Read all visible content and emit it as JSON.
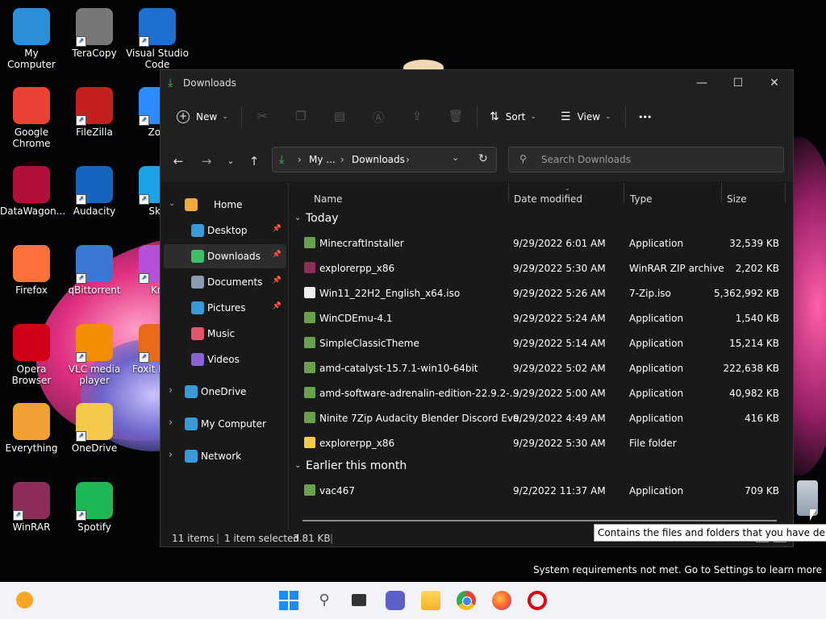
{
  "desktop": {
    "icons": [
      {
        "label": "My Computer",
        "icon": "monitor-icon"
      },
      {
        "label": "TeraCopy",
        "icon": "teracopy-icon"
      },
      {
        "label": "Visual Studio Code",
        "icon": "vscode-icon"
      },
      {
        "label": "Google Chrome",
        "icon": "chrome-icon"
      },
      {
        "label": "FileZilla",
        "icon": "filezilla-icon"
      },
      {
        "label": "Zoo",
        "icon": "zoom-icon"
      },
      {
        "label": "DataWagon...",
        "icon": "datawagon-icon"
      },
      {
        "label": "Audacity",
        "icon": "audacity-icon"
      },
      {
        "label": "Sky",
        "icon": "skype-icon"
      },
      {
        "label": "Firefox",
        "icon": "firefox-icon"
      },
      {
        "label": "qBittorrent",
        "icon": "qbittorrent-icon"
      },
      {
        "label": "Kri",
        "icon": "krita-icon"
      },
      {
        "label": "Opera Browser",
        "icon": "opera-icon"
      },
      {
        "label": "VLC media player",
        "icon": "vlc-icon"
      },
      {
        "label": "Foxit Read",
        "icon": "foxit-icon"
      },
      {
        "label": "Everything",
        "icon": "everything-icon"
      },
      {
        "label": "OneDrive",
        "icon": "onedrive-folder-icon"
      },
      {
        "label": "WinRAR",
        "icon": "winrar-icon"
      },
      {
        "label": "Spotify",
        "icon": "spotify-icon"
      }
    ],
    "system_message": "System requirements not met. Go to Settings to learn more"
  },
  "window": {
    "title": "Downloads",
    "controls": {
      "minimize": "—",
      "maximize": "☐",
      "close": "✕"
    }
  },
  "commandbar": {
    "new_label": "New",
    "sort_label": "Sort",
    "view_label": "View",
    "more_label": "•••"
  },
  "address": {
    "crumb_1": "My ...",
    "crumb_2": "Downloads",
    "separator": "›"
  },
  "search": {
    "placeholder": "Search Downloads"
  },
  "sidebar": {
    "items": [
      {
        "label": "Home",
        "icon": "home-icon",
        "expanded": true
      },
      {
        "label": "Desktop",
        "icon": "desktop-folder-icon",
        "pinned": true
      },
      {
        "label": "Downloads",
        "icon": "downloads-folder-icon",
        "pinned": true,
        "selected": true
      },
      {
        "label": "Documents",
        "icon": "documents-folder-icon",
        "pinned": true
      },
      {
        "label": "Pictures",
        "icon": "pictures-folder-icon",
        "pinned": true
      },
      {
        "label": "Music",
        "icon": "music-folder-icon"
      },
      {
        "label": "Videos",
        "icon": "videos-folder-icon"
      },
      {
        "label": "OneDrive",
        "icon": "onedrive-icon"
      },
      {
        "label": "My Computer",
        "icon": "computer-icon"
      },
      {
        "label": "Network",
        "icon": "network-icon"
      }
    ]
  },
  "columns": {
    "name": "Name",
    "date": "Date modified",
    "type": "Type",
    "size": "Size"
  },
  "groups": [
    {
      "label": "Today",
      "files": [
        {
          "name": "MinecraftInstaller",
          "date": "9/29/2022 6:01 AM",
          "type": "Application",
          "size": "32,539 KB"
        },
        {
          "name": "explorerpp_x86",
          "date": "9/29/2022 5:30 AM",
          "type": "WinRAR ZIP archive",
          "size": "2,202 KB"
        },
        {
          "name": "Win11_22H2_English_x64.iso",
          "date": "9/29/2022 5:26 AM",
          "type": "7-Zip.iso",
          "size": "5,362,992 KB"
        },
        {
          "name": "WinCDEmu-4.1",
          "date": "9/29/2022 5:24 AM",
          "type": "Application",
          "size": "1,540 KB"
        },
        {
          "name": "SimpleClassicTheme",
          "date": "9/29/2022 5:14 AM",
          "type": "Application",
          "size": "15,214 KB"
        },
        {
          "name": "amd-catalyst-15.7.1-win10-64bit",
          "date": "9/29/2022 5:02 AM",
          "type": "Application",
          "size": "222,638 KB"
        },
        {
          "name": "amd-software-adrenalin-edition-22.9.2-...",
          "date": "9/29/2022 5:00 AM",
          "type": "Application",
          "size": "40,982 KB"
        },
        {
          "name": "Ninite 7Zip Audacity Blender Discord Eve...",
          "date": "9/29/2022 4:49 AM",
          "type": "Application",
          "size": "416 KB"
        },
        {
          "name": "explorerpp_x86",
          "date": "9/29/2022 5:30 AM",
          "type": "File folder",
          "size": ""
        }
      ]
    },
    {
      "label": "Earlier this month",
      "files": [
        {
          "name": "vac467",
          "date": "9/2/2022 11:37 AM",
          "type": "Application",
          "size": "709 KB"
        }
      ]
    }
  ],
  "status": {
    "items": "11 items",
    "selected": "1 item selected",
    "size": "3.81 KB"
  },
  "tooltip": "Contains the files and folders that you have deleted.",
  "taskbar": {
    "icons": [
      "start-icon",
      "search-icon",
      "task-view-icon",
      "chat-icon",
      "file-explorer-icon",
      "chrome-icon",
      "firefox-icon",
      "opera-icon"
    ]
  }
}
